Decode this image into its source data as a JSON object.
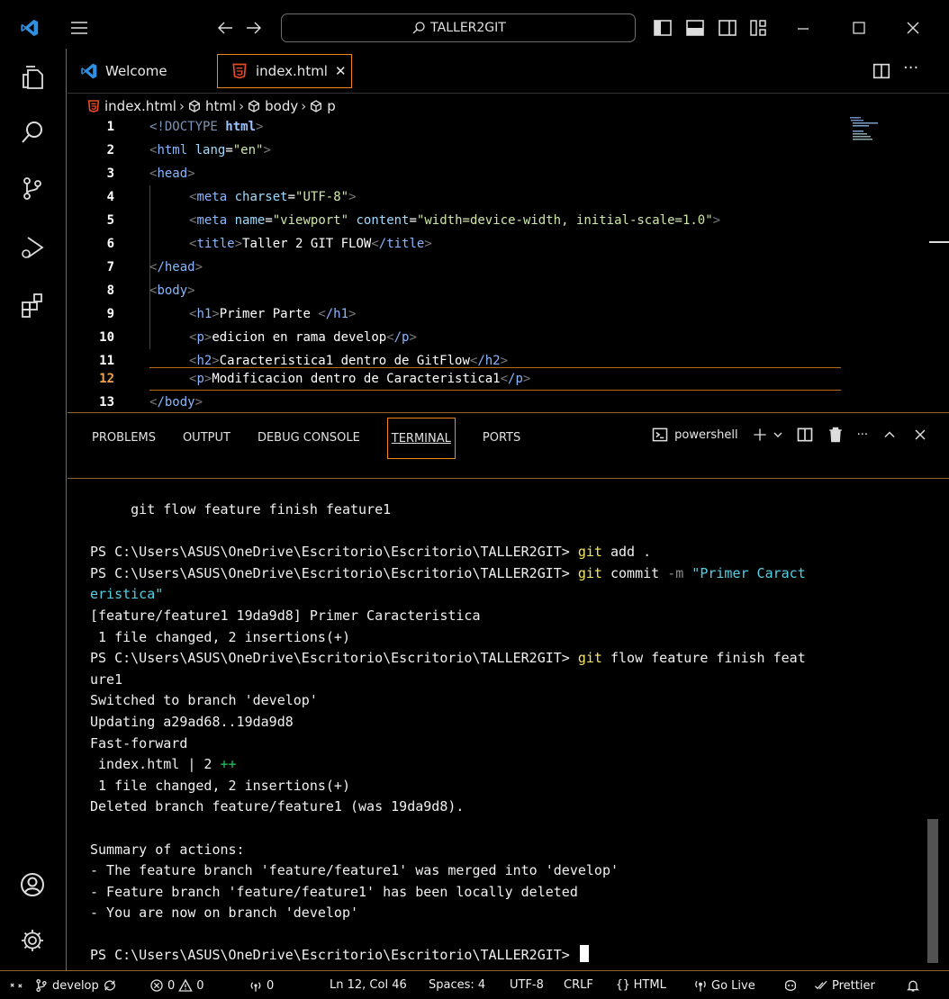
{
  "title_bar": {
    "search_text": "TALLER2GIT"
  },
  "tabs": [
    {
      "label": "Welcome"
    },
    {
      "label": "index.html",
      "close": "✕"
    }
  ],
  "breadcrumb": [
    "index.html",
    "html",
    "body",
    "p"
  ],
  "code": {
    "lines": [
      {
        "n": "1"
      },
      {
        "n": "2"
      },
      {
        "n": "3"
      },
      {
        "n": "4"
      },
      {
        "n": "5"
      },
      {
        "n": "6"
      },
      {
        "n": "7"
      },
      {
        "n": "8"
      },
      {
        "n": "9"
      },
      {
        "n": "10"
      },
      {
        "n": "11"
      },
      {
        "n": "12"
      },
      {
        "n": "13"
      }
    ],
    "t1_doctype": "<!DOCTYPE",
    "t1_html": " html",
    "t2_tag": "html",
    "t2_attr": "lang",
    "t2_val": "\"en\"",
    "t3_tag": "head",
    "t4_tag": "meta",
    "t4_attr": "charset",
    "t4_val": "\"UTF-8\"",
    "t5_tag": "meta",
    "t5_attr1": "name",
    "t5_val1": "\"viewport\"",
    "t5_attr2": "content",
    "t5_val2": "\"width=device-width, initial-scale=1.0\"",
    "t6_tag": "title",
    "t6_text": "Taller 2 GIT FLOW",
    "t7_tag": "/head",
    "t8_tag": "body",
    "t9_tag": "h1",
    "t9_text": "Primer Parte ",
    "t9_close": "/h1",
    "t10_tag": "p",
    "t10_text": "edicion en rama develop",
    "t10_close": "/p",
    "t11_tag": "h2",
    "t11_text": "Caracteristica1 dentro de GitFlow",
    "t11_close": "/h2",
    "t12_tag": "p",
    "t12_text": "Modificacion dentro de Caracteristica1",
    "t12_close": "/p",
    "t13_tag": "/body"
  },
  "panel": {
    "tabs": [
      "PROBLEMS",
      "OUTPUT",
      "DEBUG CONSOLE",
      "TERMINAL",
      "PORTS"
    ],
    "shell": "powershell",
    "ellipsis": "···"
  },
  "terminal": {
    "l1": "     git flow feature finish feature1",
    "ps": "PS C:\\Users\\ASUS\\OneDrive\\Escritorio\\Escritorio\\TALLER2GIT> ",
    "git": "git",
    "l3_rest": " add .",
    "l4_rest": " commit ",
    "l4_flag": "-m",
    "l4_str": " \"Primer Caract",
    "l5_str": "eristica\"",
    "l6": "[feature/feature1 19da9d8] Primer Caracteristica",
    "l7": " 1 file changed, 2 insertions(+)",
    "l8_rest": " flow feature finish feat",
    "l9": "ure1",
    "l10": "Switched to branch 'develop'",
    "l11": "Updating a29ad68..19da9d8",
    "l12": "Fast-forward",
    "l13": " index.html | 2 ",
    "l13_plus": "++",
    "l14": " 1 file changed, 2 insertions(+)",
    "l15": "Deleted branch feature/feature1 (was 19da9d8).",
    "l17": "Summary of actions:",
    "l18": "- The feature branch 'feature/feature1' was merged into 'develop'",
    "l19": "- Feature branch 'feature/feature1' has been locally deleted",
    "l20": "- You are now on branch 'develop'",
    "prompt": "PS C:\\Users\\ASUS\\OneDrive\\Escritorio\\Escritorio\\TALLER2GIT> "
  },
  "status": {
    "branch": "develop",
    "errors": "0",
    "warnings": "0",
    "ports": "0",
    "position": "Ln 12, Col 46",
    "spaces": "Spaces: 4",
    "encoding": "UTF-8",
    "eol": "CRLF",
    "language": "HTML",
    "golive": "Go Live",
    "prettier": "Prettier"
  },
  "colors": {
    "accent_border": "#f38518",
    "html_icon": "#e44d26",
    "vscode_blue": "#2f8fe0"
  }
}
